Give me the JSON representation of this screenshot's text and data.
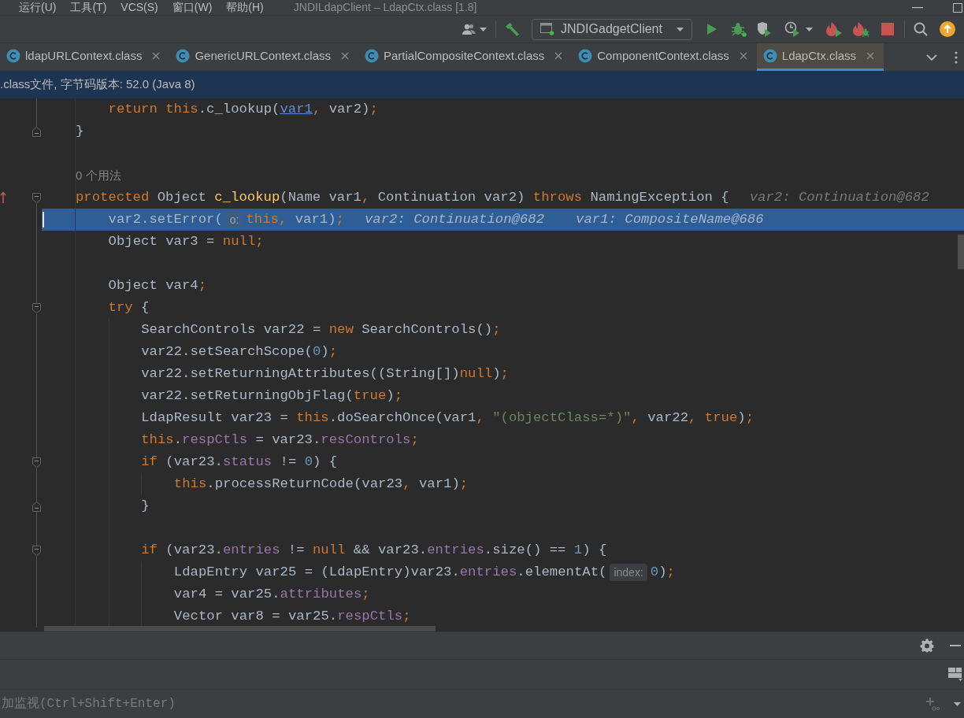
{
  "menu_bar": {
    "items": [
      "运行(U)",
      "工具(T)",
      "VCS(S)",
      "窗口(W)",
      "帮助(H)"
    ],
    "title": "JNDILdapClient – LdapCtx.class [1.8]"
  },
  "toolbar": {
    "run_configuration": "JNDIGadgetClient"
  },
  "tabs": [
    {
      "label": "ldapURLContext.class",
      "selected": false
    },
    {
      "label": "GenericURLContext.class",
      "selected": false
    },
    {
      "label": "PartialCompositeContext.class",
      "selected": false
    },
    {
      "label": "ComponentContext.class",
      "selected": false
    },
    {
      "label": "LdapCtx.class",
      "selected": true
    }
  ],
  "banner": ".class文件, 字节码版本: 52.0 (Java 8)",
  "editor": {
    "lines": [
      {
        "kind": "block",
        "children": [
          {
            "kind": "code",
            "highlighted": false,
            "overriding": false,
            "tokens": [
              {
                "kind": "keyword",
                "text": "return this"
              },
              {
                "kind": "plain",
                "text": ".c_lookup("
              },
              {
                "kind": "link",
                "text": "var1"
              },
              {
                "kind": "keyword",
                "text": ", "
              },
              {
                "kind": "plain",
                "text": "var2)"
              },
              {
                "kind": "keyword",
                "text": ";"
              }
            ]
          }
        ]
      },
      {
        "kind": "close",
        "highlighted": false,
        "overriding": false,
        "tokens": [
          {
            "kind": "plain",
            "text": "}"
          }
        ]
      },
      {
        "kind": "blank"
      },
      {
        "kind": "usage",
        "text": "0 个用法"
      },
      {
        "kind": "code",
        "highlighted": false,
        "overriding": true,
        "tokens": [
          {
            "kind": "keyword",
            "text": "protected"
          },
          {
            "kind": "plain",
            "text": " Object "
          },
          {
            "kind": "function",
            "text": "c_lookup"
          },
          {
            "kind": "plain",
            "text": "(Name var1"
          },
          {
            "kind": "keyword",
            "text": ", "
          },
          {
            "kind": "plain",
            "text": "Continuation var2) "
          },
          {
            "kind": "keyword",
            "text": "throws"
          },
          {
            "kind": "plain",
            "text": " NamingException {"
          },
          {
            "kind": "value",
            "text": "var2: Continuation@682"
          }
        ],
        "children": [
          {
            "kind": "code",
            "highlighted": true,
            "overriding": false,
            "tokens": [
              {
                "kind": "plain",
                "text": "var2.setError("
              },
              {
                "kind": "hint",
                "text": "o:"
              },
              {
                "kind": "keyword",
                "text": "this"
              },
              {
                "kind": "keyword",
                "text": ", "
              },
              {
                "kind": "plain",
                "text": "var1)"
              },
              {
                "kind": "keyword",
                "text": ";"
              },
              {
                "kind": "value",
                "text": "var2: Continuation@682"
              },
              {
                "kind": "value",
                "text": "var1: CompositeName@686"
              }
            ]
          },
          {
            "kind": "code",
            "highlighted": false,
            "overriding": false,
            "tokens": [
              {
                "kind": "plain",
                "text": "Object var3 = "
              },
              {
                "kind": "keyword",
                "text": "null"
              },
              {
                "kind": "keyword",
                "text": ";"
              }
            ]
          },
          {
            "kind": "blank"
          },
          {
            "kind": "code",
            "highlighted": false,
            "overriding": false,
            "tokens": [
              {
                "kind": "plain",
                "text": "Object var4"
              },
              {
                "kind": "keyword",
                "text": ";"
              }
            ]
          },
          {
            "kind": "code",
            "highlighted": false,
            "overriding": false,
            "tokens": [
              {
                "kind": "keyword",
                "text": "try"
              },
              {
                "kind": "plain",
                "text": " {"
              }
            ],
            "children": [
              {
                "kind": "code",
                "highlighted": false,
                "overriding": false,
                "tokens": [
                  {
                    "kind": "plain",
                    "text": "SearchControls var22 = "
                  },
                  {
                    "kind": "keyword",
                    "text": "new"
                  },
                  {
                    "kind": "plain",
                    "text": " SearchControls()"
                  },
                  {
                    "kind": "keyword",
                    "text": ";"
                  }
                ]
              },
              {
                "kind": "code",
                "highlighted": false,
                "overriding": false,
                "tokens": [
                  {
                    "kind": "plain",
                    "text": "var22.setSearchScope("
                  },
                  {
                    "kind": "number",
                    "text": "0"
                  },
                  {
                    "kind": "plain",
                    "text": ")"
                  },
                  {
                    "kind": "keyword",
                    "text": ";"
                  }
                ]
              },
              {
                "kind": "code",
                "highlighted": false,
                "overriding": false,
                "tokens": [
                  {
                    "kind": "plain",
                    "text": "var22.setReturningAttributes((String[])"
                  },
                  {
                    "kind": "keyword",
                    "text": "null"
                  },
                  {
                    "kind": "plain",
                    "text": ")"
                  },
                  {
                    "kind": "keyword",
                    "text": ";"
                  }
                ]
              },
              {
                "kind": "code",
                "highlighted": false,
                "overriding": false,
                "tokens": [
                  {
                    "kind": "plain",
                    "text": "var22.setReturningObjFlag("
                  },
                  {
                    "kind": "keyword",
                    "text": "true"
                  },
                  {
                    "kind": "plain",
                    "text": ")"
                  },
                  {
                    "kind": "keyword",
                    "text": ";"
                  }
                ]
              },
              {
                "kind": "code",
                "highlighted": false,
                "overriding": false,
                "tokens": [
                  {
                    "kind": "plain",
                    "text": "LdapResult var23 = "
                  },
                  {
                    "kind": "keyword",
                    "text": "this"
                  },
                  {
                    "kind": "plain",
                    "text": ".doSearchOnce(var1"
                  },
                  {
                    "kind": "keyword",
                    "text": ", "
                  },
                  {
                    "kind": "string",
                    "text": "\"(objectClass=*)\""
                  },
                  {
                    "kind": "keyword",
                    "text": ", "
                  },
                  {
                    "kind": "plain",
                    "text": "var22"
                  },
                  {
                    "kind": "keyword",
                    "text": ", "
                  },
                  {
                    "kind": "keyword",
                    "text": "true"
                  },
                  {
                    "kind": "plain",
                    "text": ")"
                  },
                  {
                    "kind": "keyword",
                    "text": ";"
                  }
                ]
              },
              {
                "kind": "code",
                "highlighted": false,
                "overriding": false,
                "tokens": [
                  {
                    "kind": "keyword",
                    "text": "this"
                  },
                  {
                    "kind": "plain",
                    "text": "."
                  },
                  {
                    "kind": "field",
                    "text": "respCtls"
                  },
                  {
                    "kind": "plain",
                    "text": " = var23."
                  },
                  {
                    "kind": "field",
                    "text": "resControls"
                  },
                  {
                    "kind": "keyword",
                    "text": ";"
                  }
                ]
              },
              {
                "kind": "code",
                "highlighted": false,
                "overriding": false,
                "tokens": [
                  {
                    "kind": "keyword",
                    "text": "if"
                  },
                  {
                    "kind": "plain",
                    "text": " (var23."
                  },
                  {
                    "kind": "field",
                    "text": "status"
                  },
                  {
                    "kind": "plain",
                    "text": " != "
                  },
                  {
                    "kind": "number",
                    "text": "0"
                  },
                  {
                    "kind": "plain",
                    "text": ") {"
                  }
                ],
                "children": [
                  {
                    "kind": "code",
                    "highlighted": false,
                    "overriding": false,
                    "tokens": [
                      {
                        "kind": "keyword",
                        "text": "this"
                      },
                      {
                        "kind": "plain",
                        "text": ".processReturnCode(var23"
                      },
                      {
                        "kind": "keyword",
                        "text": ", "
                      },
                      {
                        "kind": "plain",
                        "text": "var1)"
                      },
                      {
                        "kind": "keyword",
                        "text": ";"
                      }
                    ]
                  }
                ]
              },
              {
                "kind": "close",
                "highlighted": false,
                "overriding": false,
                "tokens": [
                  {
                    "kind": "plain",
                    "text": "}"
                  }
                ]
              },
              {
                "kind": "blank"
              },
              {
                "kind": "code",
                "highlighted": false,
                "overriding": false,
                "tokens": [
                  {
                    "kind": "keyword",
                    "text": "if"
                  },
                  {
                    "kind": "plain",
                    "text": " (var23."
                  },
                  {
                    "kind": "field",
                    "text": "entries"
                  },
                  {
                    "kind": "plain",
                    "text": " != "
                  },
                  {
                    "kind": "keyword",
                    "text": "null"
                  },
                  {
                    "kind": "plain",
                    "text": " && var23."
                  },
                  {
                    "kind": "field",
                    "text": "entries"
                  },
                  {
                    "kind": "plain",
                    "text": ".size() == "
                  },
                  {
                    "kind": "number",
                    "text": "1"
                  },
                  {
                    "kind": "plain",
                    "text": ") {"
                  }
                ],
                "children": [
                  {
                    "kind": "code",
                    "highlighted": false,
                    "overriding": false,
                    "tokens": [
                      {
                        "kind": "plain",
                        "text": "LdapEntry var25 = (LdapEntry)var23."
                      },
                      {
                        "kind": "field",
                        "text": "entries"
                      },
                      {
                        "kind": "plain",
                        "text": ".elementAt("
                      },
                      {
                        "kind": "hint",
                        "text": "index:"
                      },
                      {
                        "kind": "number",
                        "text": "0"
                      },
                      {
                        "kind": "plain",
                        "text": ")"
                      },
                      {
                        "kind": "keyword",
                        "text": ";"
                      }
                    ]
                  },
                  {
                    "kind": "code",
                    "highlighted": false,
                    "overriding": false,
                    "tokens": [
                      {
                        "kind": "plain",
                        "text": "var4 = var25."
                      },
                      {
                        "kind": "field",
                        "text": "attributes"
                      },
                      {
                        "kind": "keyword",
                        "text": ";"
                      }
                    ]
                  },
                  {
                    "kind": "code",
                    "highlighted": false,
                    "overriding": false,
                    "tokens": [
                      {
                        "kind": "plain",
                        "text": "Vector var8 = var25."
                      },
                      {
                        "kind": "field",
                        "text": "respCtls"
                      },
                      {
                        "kind": "keyword",
                        "text": ";"
                      }
                    ]
                  }
                ]
              }
            ]
          }
        ]
      }
    ]
  },
  "watches": {
    "placeholder": "加监视(Ctrl+Shift+Enter)"
  }
}
